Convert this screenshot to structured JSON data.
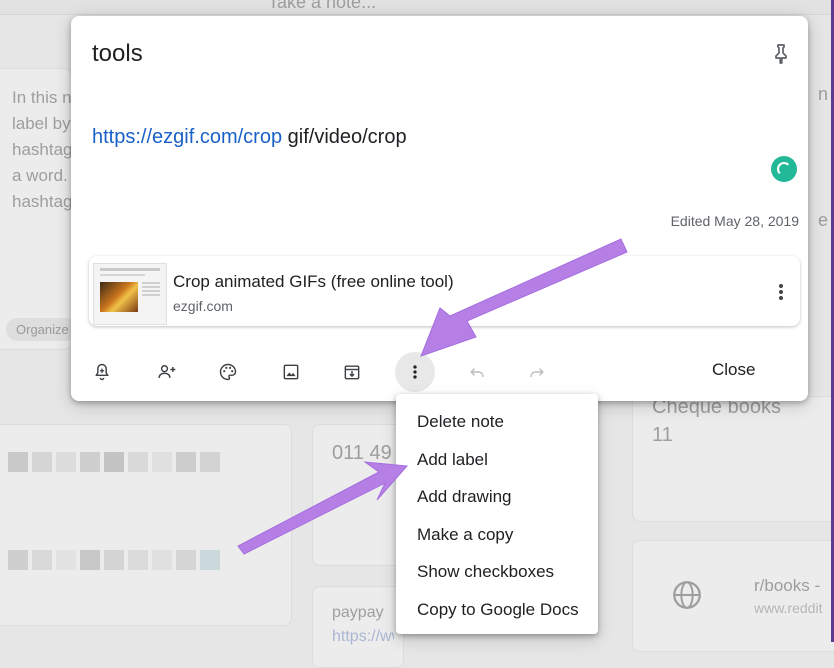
{
  "background": {
    "top_placeholder": "Take a note...",
    "left_note_lines": [
      "In this n",
      "label by",
      "hashtag",
      "a word.",
      "hashtag"
    ],
    "left_chip": "Organize",
    "mid_note_number": "011 49",
    "right_note_title": "Cheque books",
    "right_note_number": "11",
    "right_link_title": "r/books -",
    "right_link_domain": "www.reddit",
    "bottom_note_text": "paypay",
    "bottom_note_link": "https://www.paypal.me/ox"
  },
  "note": {
    "title": "tools",
    "body_link": "https://ezgif.com/crop",
    "body_text": " gif/video/crop",
    "edited": "Edited May 28, 2019",
    "link_card": {
      "title": "Crop animated GIFs (free online tool)",
      "domain": "ezgif.com"
    },
    "close_label": "Close"
  },
  "toolbar_icons": [
    "bell-plus-icon",
    "add-collaborator-icon",
    "palette-icon",
    "image-icon",
    "archive-icon",
    "more-vert-icon",
    "undo-icon",
    "redo-icon"
  ],
  "menu": {
    "items": [
      "Delete note",
      "Add label",
      "Add drawing",
      "Make a copy",
      "Show checkboxes",
      "Copy to Google Docs"
    ]
  },
  "colors": {
    "link": "#1a61c7",
    "sync_badge": "#23b898",
    "annotation_arrow": "#b57fe6"
  }
}
